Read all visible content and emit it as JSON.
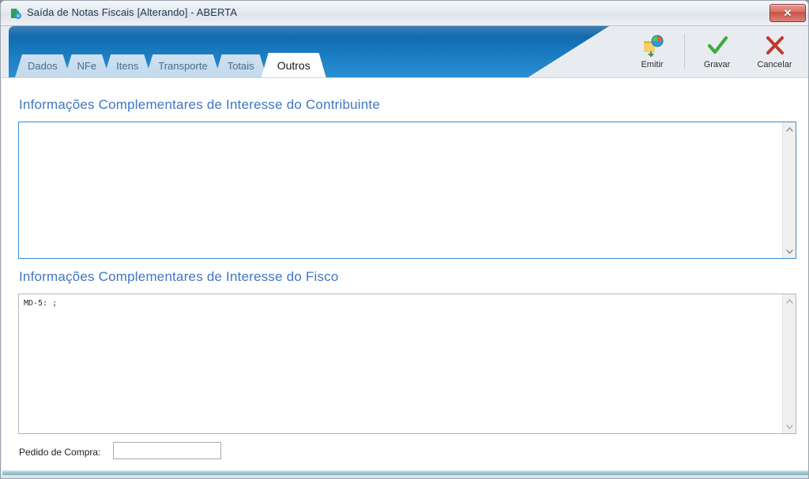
{
  "window": {
    "title": "Saída de Notas Fiscais [Alterando]  - ABERTA",
    "app_icon": "document-app-icon",
    "close_label": "✕",
    "close_icon": "close-icon"
  },
  "tabs": [
    {
      "label": "Dados",
      "active": false
    },
    {
      "label": "NFe",
      "active": false
    },
    {
      "label": "Itens",
      "active": false
    },
    {
      "label": "Transporte",
      "active": false
    },
    {
      "label": "Totais",
      "active": false
    },
    {
      "label": "Outros",
      "active": true
    }
  ],
  "toolbar": {
    "buttons": [
      {
        "label": "Emitir",
        "icon": "publish-globe-icon"
      },
      {
        "label": "Gravar",
        "icon": "check-icon"
      },
      {
        "label": "Cancelar",
        "icon": "cancel-x-icon"
      }
    ]
  },
  "main": {
    "contribuinte": {
      "label": "Informações Complementares de Interesse do Contribuinte",
      "value": "",
      "focused": true
    },
    "fisco": {
      "label": "Informações Complementares de Interesse do Fisco",
      "value": "MD-5: ;",
      "focused": false
    },
    "pedido": {
      "label": "Pedido de Compra:",
      "value": "",
      "placeholder": ""
    },
    "scroll_up_icon": "chevron-up-icon",
    "scroll_down_icon": "chevron-down-icon"
  },
  "colors": {
    "accent_blue": "#1b7cc2",
    "label_blue": "#4076c0",
    "focus_border": "#3a8fd4",
    "tab_inactive": "#c3d9ec",
    "close_red": "#c85247",
    "check_green": "#3faa3f",
    "cancel_red": "#c0392b",
    "bottom_edge": "#9cc5cc"
  }
}
